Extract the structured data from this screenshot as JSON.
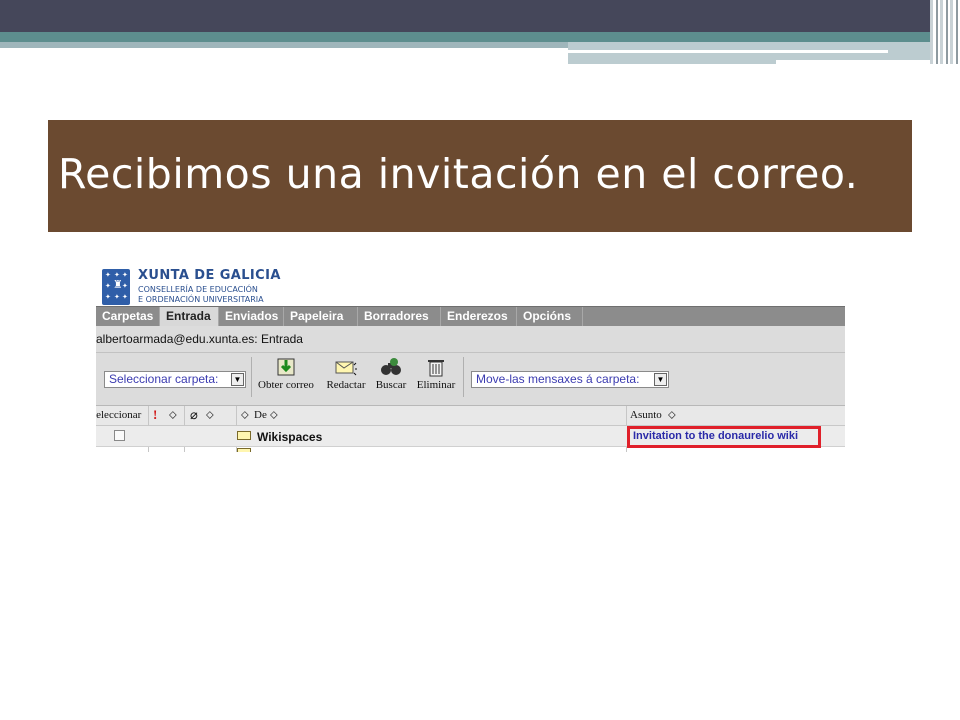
{
  "slide": {
    "title": "Recibimos una invitación en el correo."
  },
  "logo": {
    "title": "XUNTA DE GALICIA",
    "line1": "CONSELLERÍA DE EDUCACIÓN",
    "line2": "E ORDENACIÓN UNIVERSITARIA"
  },
  "tabs": [
    {
      "label": "Carpetas"
    },
    {
      "label": "Entrada"
    },
    {
      "label": "Enviados"
    },
    {
      "label": "Papeleira"
    },
    {
      "label": "Borradores"
    },
    {
      "label": "Enderezos"
    },
    {
      "label": "Opcións"
    }
  ],
  "address": "albertoarmada@edu.xunta.es: Entrada",
  "toolbar": {
    "select_folder": "Seleccionar carpeta:",
    "get_mail": "Obter correo",
    "compose": "Redactar",
    "search": "Buscar",
    "delete": "Eliminar",
    "move_to": "Move-las mensaxes á carpeta:"
  },
  "headers": {
    "select": "Seleccionar",
    "exclaim": "!",
    "from": "De",
    "subject": "Asunto",
    "sort_glyph": "⬦"
  },
  "messages": [
    {
      "from": "Wikispaces",
      "subject": "Invitation to the donaurelio wiki"
    }
  ],
  "colors": {
    "title_band": "#6b4a30",
    "highlight": "#e0202a",
    "link": "#2a2aa8"
  }
}
